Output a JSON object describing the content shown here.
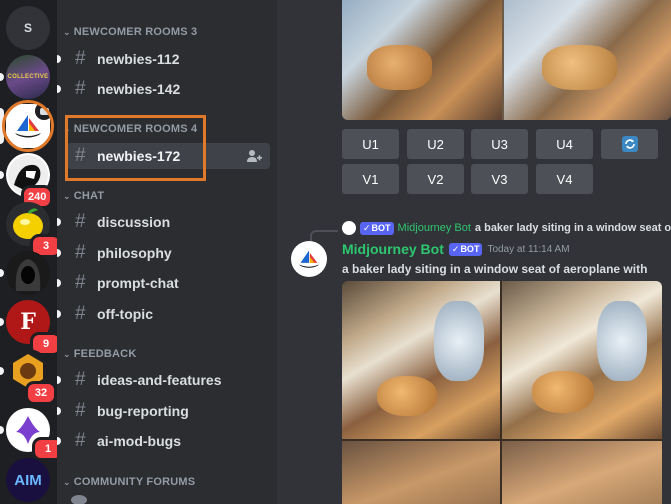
{
  "servers": [
    {
      "name": "home",
      "letter": "S"
    },
    {
      "name": "collective",
      "label": "COLLECTIVE"
    },
    {
      "name": "midjourney",
      "selected": true
    },
    {
      "name": "server-4",
      "badge": "240"
    },
    {
      "name": "server-5",
      "badge": "3"
    },
    {
      "name": "server-6"
    },
    {
      "name": "server-7",
      "badge": "9"
    },
    {
      "name": "server-8",
      "badge": "32"
    },
    {
      "name": "server-9",
      "badge": "1"
    },
    {
      "name": "server-10",
      "label": "AIM"
    }
  ],
  "categories": {
    "newcomer3": "NEWCOMER ROOMS 3",
    "newcomer4": "NEWCOMER ROOMS 4",
    "chat": "CHAT",
    "feedback": "FEEDBACK",
    "community": "COMMUNITY FORUMS"
  },
  "channels": {
    "newbies112": "newbies-112",
    "newbies142": "newbies-142",
    "newbies172": "newbies-172",
    "discussion": "discussion",
    "philosophy": "philosophy",
    "promptchat": "prompt-chat",
    "offtopic": "off-topic",
    "ideas": "ideas-and-features",
    "bug": "bug-reporting",
    "aimod": "ai-mod-bugs"
  },
  "buttons": {
    "u1": "U1",
    "u2": "U2",
    "u3": "U3",
    "u4": "U4",
    "v1": "V1",
    "v2": "V2",
    "v3": "V3",
    "v4": "V4"
  },
  "message": {
    "reply_author": "Midjourney Bot",
    "reply_text": "a baker lady siting in a window seat of aeroplane with",
    "bot_tag": "BOT",
    "author": "Midjourney Bot",
    "timestamp": "Today at 11:14 AM",
    "text": "a baker lady siting in a window seat of aeroplane with"
  },
  "colors": {
    "accent_green": "#2dc770",
    "highlight": "#e07a2a",
    "blurple": "#5865f2",
    "mention_red": "#f23f43"
  }
}
